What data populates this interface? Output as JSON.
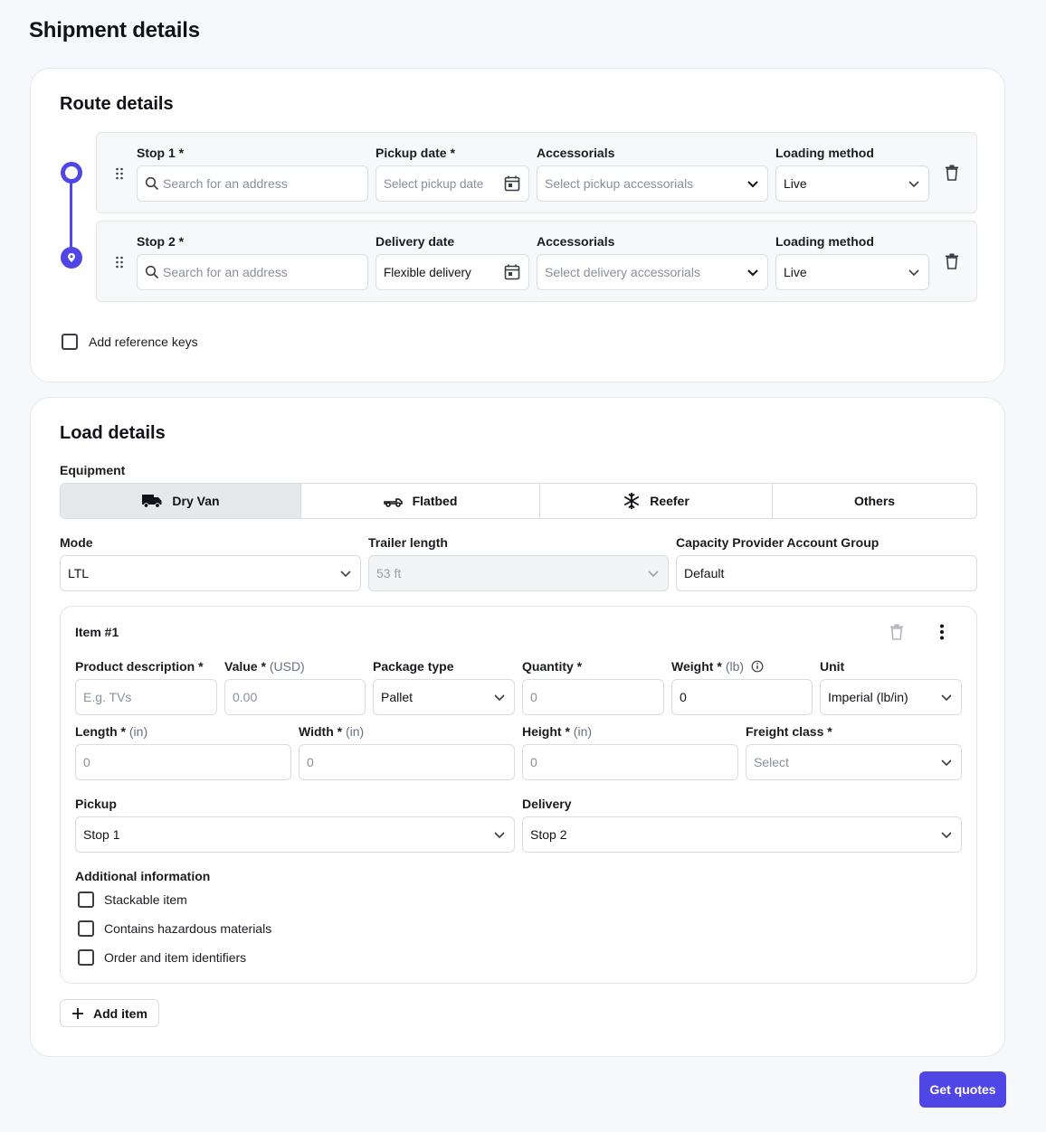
{
  "page_title": "Shipment details",
  "route": {
    "title": "Route details",
    "stops": [
      {
        "stop_label": "Stop 1",
        "address_placeholder": "Search for an address",
        "date_label": "Pickup date",
        "date_value": "Select pickup date",
        "accessorials_label": "Accessorials",
        "accessorials_placeholder": "Select pickup accessorials",
        "loading_label": "Loading method",
        "loading_value": "Live"
      },
      {
        "stop_label": "Stop 2",
        "address_placeholder": "Search for an address",
        "date_label": "Delivery date",
        "date_value": "Flexible delivery",
        "accessorials_label": "Accessorials",
        "accessorials_placeholder": "Select delivery accessorials",
        "loading_label": "Loading method",
        "loading_value": "Live"
      }
    ],
    "required_mark": "*",
    "reference_keys_label": "Add reference keys"
  },
  "load": {
    "title": "Load details",
    "equipment_label": "Equipment",
    "equipment_options": [
      {
        "label": "Dry Van",
        "icon": "truck-icon",
        "selected": true
      },
      {
        "label": "Flatbed",
        "icon": "flatbed-icon",
        "selected": false
      },
      {
        "label": "Reefer",
        "icon": "snowflake-icon",
        "selected": false
      },
      {
        "label": "Others",
        "icon": "",
        "selected": false
      }
    ],
    "mode_label": "Mode",
    "mode_value": "LTL",
    "trailer_label": "Trailer length",
    "trailer_value": "53 ft",
    "capacity_label": "Capacity Provider Account Group",
    "capacity_value": "Default",
    "item": {
      "title": "Item #1",
      "product_label": "Product description",
      "product_placeholder": "E.g. TVs",
      "value_label": "Value",
      "value_unit": "(USD)",
      "value_placeholder": "0.00",
      "package_label": "Package type",
      "package_value": "Pallet",
      "quantity_label": "Quantity",
      "quantity_placeholder": "0",
      "weight_label": "Weight",
      "weight_unit": "(lb)",
      "weight_value": "0",
      "unit_label": "Unit",
      "unit_value": "Imperial (lb/in)",
      "length_label": "Length",
      "length_unit": "(in)",
      "length_placeholder": "0",
      "width_label": "Width",
      "width_unit": "(in)",
      "width_placeholder": "0",
      "height_label": "Height",
      "height_unit": "(in)",
      "height_placeholder": "0",
      "freight_label": "Freight class",
      "freight_placeholder": "Select",
      "pickup_label": "Pickup",
      "pickup_value": "Stop 1",
      "delivery_label": "Delivery",
      "delivery_value": "Stop 2",
      "additional_label": "Additional information",
      "checkboxes": [
        "Stackable item",
        "Contains hazardous materials",
        "Order and item identifiers"
      ]
    },
    "add_item_label": "Add item"
  },
  "get_quotes_label": "Get quotes",
  "colors": {
    "accent": "#5046e5",
    "background": "#f7f8fb"
  }
}
